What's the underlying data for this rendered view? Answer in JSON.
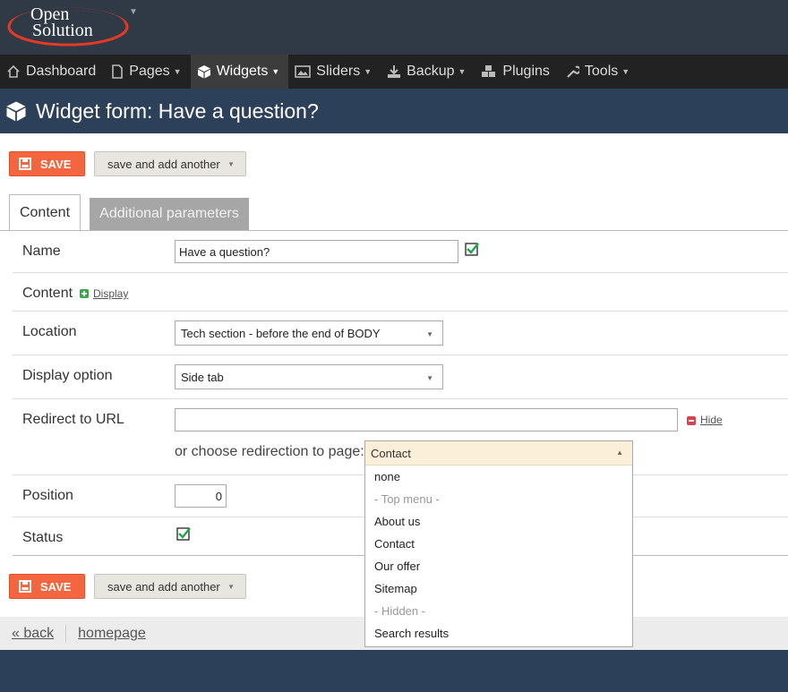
{
  "logo": {
    "line1": "Open",
    "line2": "Solution"
  },
  "nav": [
    {
      "label": "Dashboard",
      "icon": "home-icon",
      "has_caret": false
    },
    {
      "label": "Pages",
      "icon": "pages-icon",
      "has_caret": true
    },
    {
      "label": "Widgets",
      "icon": "cube-icon",
      "has_caret": true,
      "active": true
    },
    {
      "label": "Sliders",
      "icon": "image-icon",
      "has_caret": true
    },
    {
      "label": "Backup",
      "icon": "download-icon",
      "has_caret": true
    },
    {
      "label": "Plugins",
      "icon": "cubes-icon",
      "has_caret": false
    },
    {
      "label": "Tools",
      "icon": "wrench-icon",
      "has_caret": true
    }
  ],
  "page_title": "Widget form: Have a question?",
  "buttons": {
    "save": "SAVE",
    "save_and_add": "save and add another"
  },
  "tabs": {
    "content": "Content",
    "additional": "Additional parameters"
  },
  "form": {
    "name_label": "Name",
    "name_value": "Have a question?",
    "content_label": "Content",
    "content_toggle": "Display",
    "location_label": "Location",
    "location_value": "Tech section - before the end of BODY",
    "display_label": "Display option",
    "display_value": "Side tab",
    "redirect_label": "Redirect to URL",
    "redirect_value": "",
    "redirect_toggle": "Hide",
    "redirect_page_label": "or choose redirection to page:",
    "redirect_page_value": "Contact",
    "position_label": "Position",
    "position_value": "0",
    "status_label": "Status",
    "status_checked": true
  },
  "dropdown_options": [
    {
      "label": "none",
      "group": false
    },
    {
      "label": "- Top menu -",
      "group": true
    },
    {
      "label": "About us",
      "group": false
    },
    {
      "label": "Contact",
      "group": false
    },
    {
      "label": "Our offer",
      "group": false
    },
    {
      "label": "Sitemap",
      "group": false
    },
    {
      "label": "- Hidden -",
      "group": true
    },
    {
      "label": "Search results",
      "group": false
    }
  ],
  "footer": {
    "back": "« back",
    "homepage": "homepage"
  },
  "colors": {
    "accent": "#f4663f",
    "header": "#2d4059",
    "nav": "#222222"
  }
}
